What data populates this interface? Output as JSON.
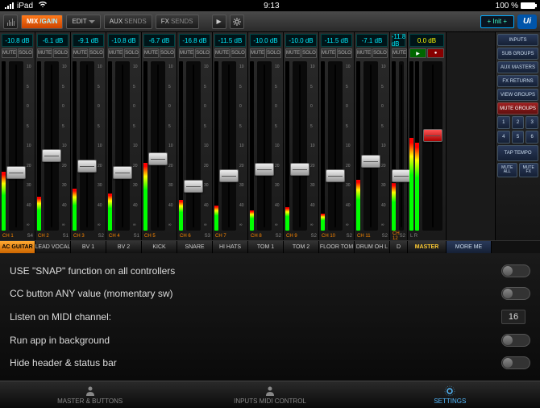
{
  "status": {
    "carrier": "iPad",
    "wifi": true,
    "time": "9:13",
    "battery_pct": "100 %",
    "battery_level": 100
  },
  "toolbar": {
    "mix": "MIX",
    "gain": "/GAIN",
    "edit": "EDIT",
    "aux": "AUX",
    "sends": "SENDS",
    "fx": "FX",
    "fxsends": "SENDS",
    "init": "+ Init +",
    "logo": "Ui"
  },
  "sidebar": {
    "inputs": "INPUTS",
    "sub": "SUB GROUPS",
    "auxm": "AUX MASTERS",
    "fxret": "FX RETURNS",
    "viewg": "VIEW GROUPS",
    "muteg": "MUTE GROUPS",
    "nums": [
      "1",
      "2",
      "3",
      "4",
      "5",
      "6"
    ],
    "tap": "TAP TEMPO",
    "muteall": "MUTE\nALL",
    "mutefx": "MUTE\nFX",
    "moreme": "MORE ME"
  },
  "scale": [
    "10",
    "5",
    "0",
    "5",
    "10",
    "20",
    "30",
    "40",
    "∞"
  ],
  "channels": [
    {
      "db": "-10.8 dB",
      "mute": "MUTE",
      "solo": "SOLO",
      "id": "CH 1",
      "sub": "S4",
      "label": "AC GUITAR",
      "fader": 62,
      "meter": 35,
      "sel": true
    },
    {
      "db": "-6.1 dB",
      "mute": "MUTE",
      "solo": "SOLO",
      "id": "CH 2",
      "sub": "S1",
      "label": "LEAD VOCAL",
      "fader": 52,
      "meter": 20
    },
    {
      "db": "-9.1 dB",
      "mute": "MUTE",
      "solo": "SOLO",
      "id": "CH 3",
      "sub": "S2",
      "label": "BV 1",
      "fader": 58,
      "meter": 25
    },
    {
      "db": "-10.8 dB",
      "mute": "MUTE",
      "solo": "SOLO",
      "id": "CH 4",
      "sub": "S1",
      "label": "BV 2",
      "fader": 62,
      "meter": 22
    },
    {
      "db": "-6.7 dB",
      "mute": "MUTE",
      "solo": "SOLO",
      "id": "CH 5",
      "sub": "",
      "label": "KICK",
      "fader": 54,
      "meter": 40
    },
    {
      "db": "-16.8 dB",
      "mute": "MUTE",
      "solo": "SOLO",
      "id": "CH 6",
      "sub": "S3",
      "label": "SNARE",
      "fader": 70,
      "meter": 18
    },
    {
      "db": "-11.5 dB",
      "mute": "MUTE",
      "solo": "SOLO",
      "id": "CH 7",
      "sub": "",
      "label": "HI HATS",
      "fader": 64,
      "meter": 15
    },
    {
      "db": "-10.0 dB",
      "mute": "MUTE",
      "solo": "SOLO",
      "id": "CH 8",
      "sub": "S2",
      "label": "TOM 1",
      "fader": 60,
      "meter": 12
    },
    {
      "db": "-10.0 dB",
      "mute": "MUTE",
      "solo": "SOLO",
      "id": "CH 9",
      "sub": "S2",
      "label": "TOM 2",
      "fader": 60,
      "meter": 14
    },
    {
      "db": "-11.5 dB",
      "mute": "MUTE",
      "solo": "SOLO",
      "id": "CH 10",
      "sub": "S2",
      "label": "FLOOR TOM",
      "fader": 64,
      "meter": 10
    },
    {
      "db": "-7.1 dB",
      "mute": "MUTE",
      "solo": "SOLO",
      "id": "CH 11",
      "sub": "S2",
      "label": "DRUM OH L",
      "fader": 55,
      "meter": 30
    },
    {
      "db": "-11.8 dB",
      "mute": "MUTE",
      "solo": "SOLO",
      "id": "CH 12",
      "sub": "S2",
      "label": "D",
      "fader": 64,
      "meter": 28,
      "narrow": true
    }
  ],
  "master": {
    "db": "0.0 dB",
    "id": "L   R",
    "label": "MASTER",
    "fader": 40,
    "meterL": 55,
    "meterR": 52,
    "play": "▶",
    "rec": "●"
  },
  "settings": {
    "rows": [
      {
        "label": "USE \"SNAP\" function on all controllers",
        "type": "toggle",
        "on": false
      },
      {
        "label": "CC button ANY value (momentary sw)",
        "type": "toggle",
        "on": false
      },
      {
        "label": "Listen on MIDI channel:",
        "type": "value",
        "value": "16"
      },
      {
        "label": "Run app in background",
        "type": "toggle",
        "on": false
      },
      {
        "label": "Hide header & status bar",
        "type": "toggle",
        "on": false
      }
    ]
  },
  "tabs": {
    "t1": "MASTER & BUTTONS",
    "t2": "INPUTS MIDI CONTROL",
    "t3": "SETTINGS",
    "active": 2
  }
}
